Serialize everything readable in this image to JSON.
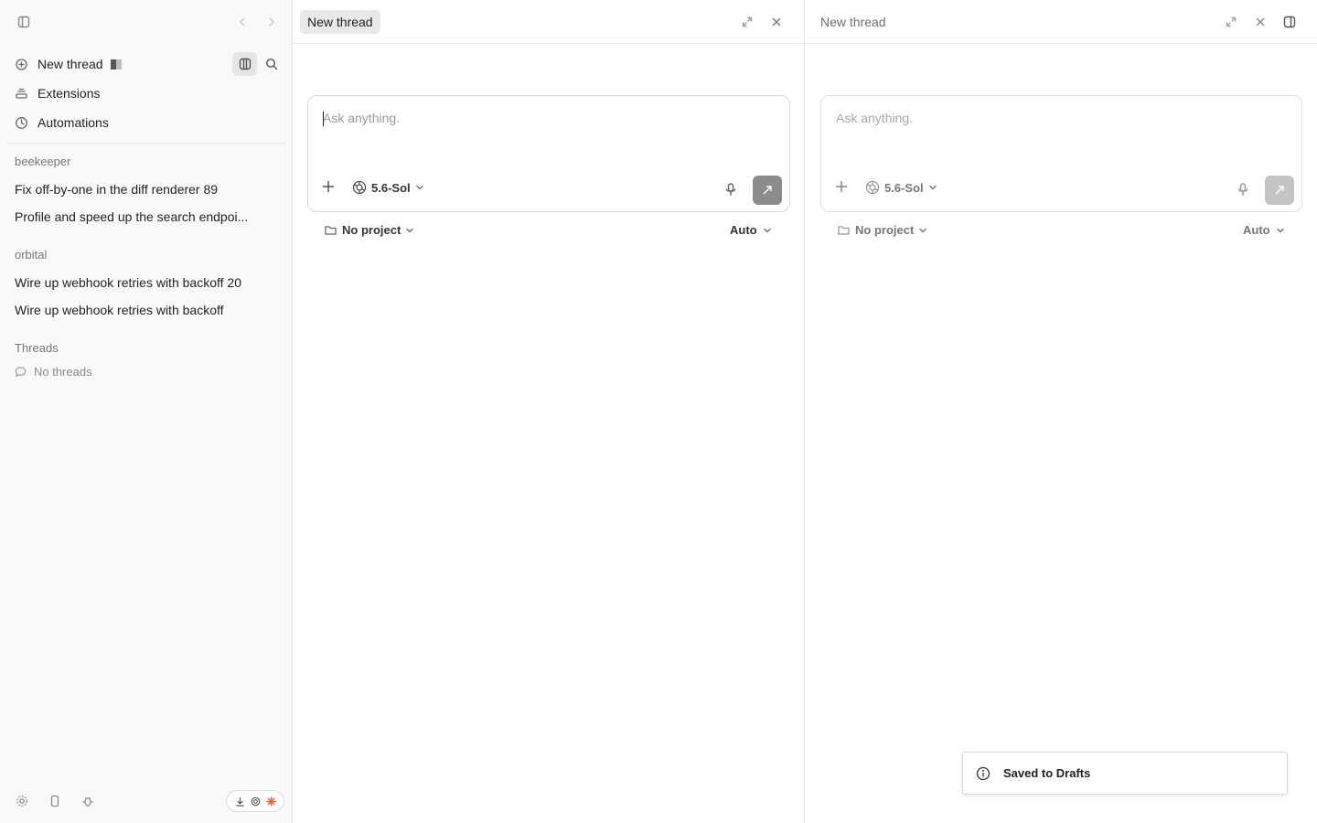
{
  "sidebar": {
    "nav": [
      {
        "label": "New thread",
        "icon": "new-thread-icon"
      },
      {
        "label": "Extensions",
        "icon": "extensions-icon"
      },
      {
        "label": "Automations",
        "icon": "clock-icon"
      }
    ],
    "groups": [
      {
        "label": "beekeeper",
        "threads": [
          "Fix off-by-one in the diff renderer 89",
          "Profile and speed up the search endpoi..."
        ]
      },
      {
        "label": "orbital",
        "threads": [
          "Wire up webhook retries with backoff 20",
          "Wire up webhook retries with backoff"
        ]
      },
      {
        "label": "Threads",
        "empty_label": "No threads"
      }
    ]
  },
  "panes": [
    {
      "tab_label": "New thread",
      "composer": {
        "placeholder": "Ask anything.",
        "model": "5.6-Sol"
      },
      "project": "No project",
      "mode": "Auto"
    },
    {
      "tab_label": "New thread",
      "composer": {
        "placeholder": "Ask anything.",
        "model": "5.6-Sol"
      },
      "project": "No project",
      "mode": "Auto"
    }
  ],
  "toast": {
    "text": "Saved to Drafts",
    "icon": "info-icon"
  },
  "colors": {
    "send_active": "#8c8c8c",
    "send_disabled": "#c4c4c4",
    "accent_orange": "#e0603a"
  }
}
